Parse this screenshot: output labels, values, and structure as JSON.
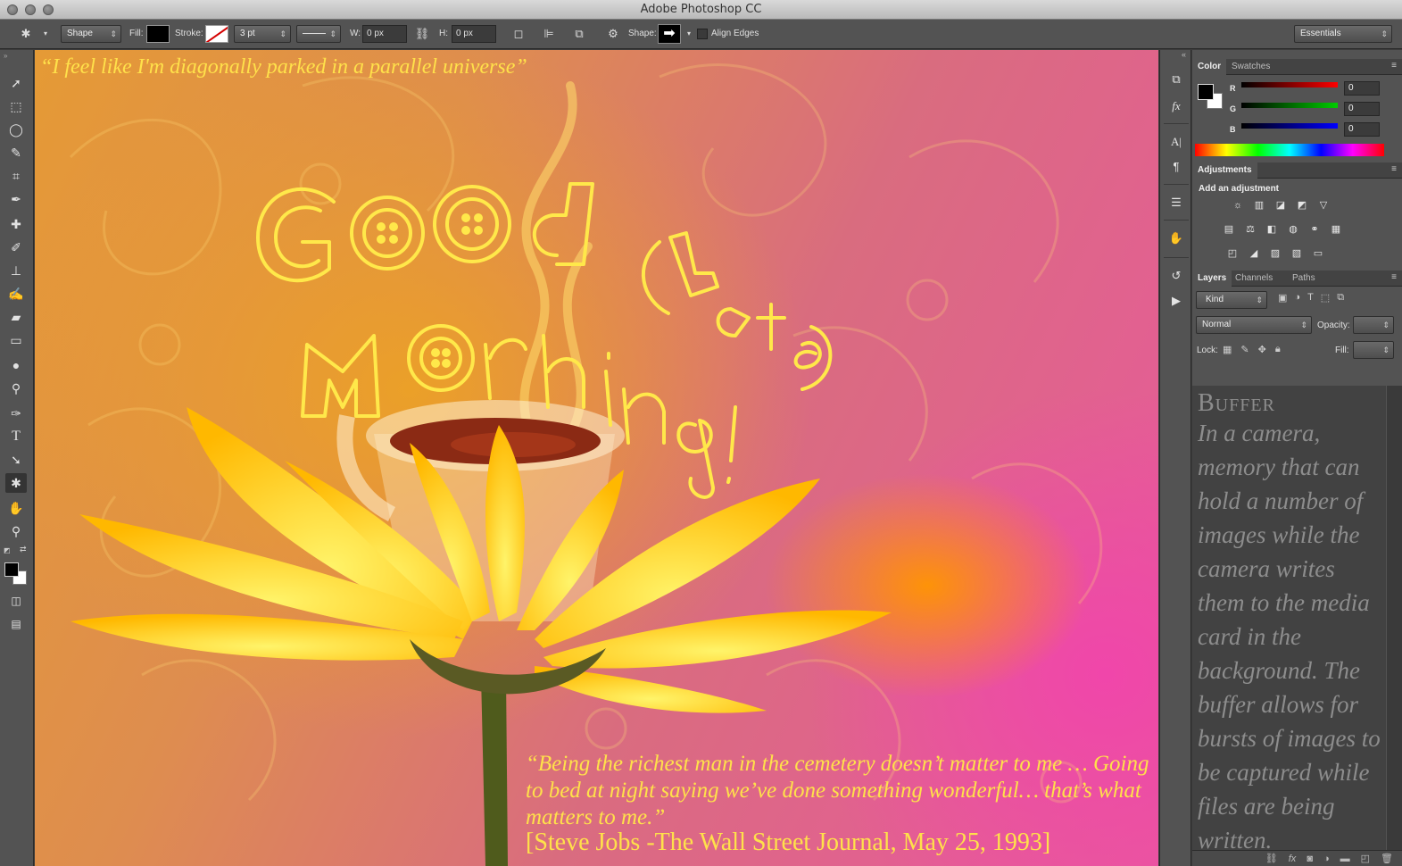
{
  "window": {
    "title": "Adobe Photoshop CC"
  },
  "options_bar": {
    "mode": "Shape",
    "fill_label": "Fill:",
    "stroke_label": "Stroke:",
    "stroke_width": "3 pt",
    "w_label": "W:",
    "w_value": "0 px",
    "h_label": "H:",
    "h_value": "0 px",
    "shape_label": "Shape:",
    "align_edges_label": "Align Edges",
    "workspace": "Essentials"
  },
  "toolbar": {
    "tools": [
      "move",
      "marquee",
      "lasso",
      "quick-select",
      "crop",
      "eyedropper",
      "healing",
      "brush",
      "stamp",
      "history-brush",
      "eraser",
      "gradient",
      "blur",
      "dodge",
      "pen",
      "type",
      "path-select",
      "custom-shape",
      "hand",
      "zoom"
    ],
    "active_tool": "custom-shape"
  },
  "canvas": {
    "quote_top": "“I feel like I'm diagonally parked in a parallel universe”",
    "quote_bottom": "“Being the richest man in the cemetery doesn’t matter to me … Going to bed at night saying we’ve done something wonderful… that’s what matters to me.”",
    "quote_cite": "[Steve Jobs -The Wall Street Journal, May 25, 1993]",
    "art_line1": "GOOd",
    "art_line2": "(Late)",
    "art_line3": "Morning!"
  },
  "color_panel": {
    "tabs": [
      "Color",
      "Swatches"
    ],
    "active_tab": "Color",
    "r_label": "R",
    "g_label": "G",
    "b_label": "B",
    "r_value": "0",
    "g_value": "0",
    "b_value": "0"
  },
  "adjustments_panel": {
    "tab": "Adjustments",
    "heading": "Add an adjustment"
  },
  "layers_panel": {
    "tabs": [
      "Layers",
      "Channels",
      "Paths"
    ],
    "active_tab": "Layers",
    "filter": "Kind",
    "blend_mode": "Normal",
    "opacity_label": "Opacity:",
    "lock_label": "Lock:",
    "fill_label": "Fill:"
  },
  "overlay_text": {
    "title": "Buffer",
    "body": "In a camera, memory that can hold a number of images while the camera writes them to the media card in the background. The buffer allows for bursts of images to be captured while files are being written."
  },
  "colors": {
    "accent_text": "#ffe14a",
    "panel_bg": "#535353",
    "canvas_pink": "#e9589e",
    "canvas_orange": "#e59a35"
  }
}
